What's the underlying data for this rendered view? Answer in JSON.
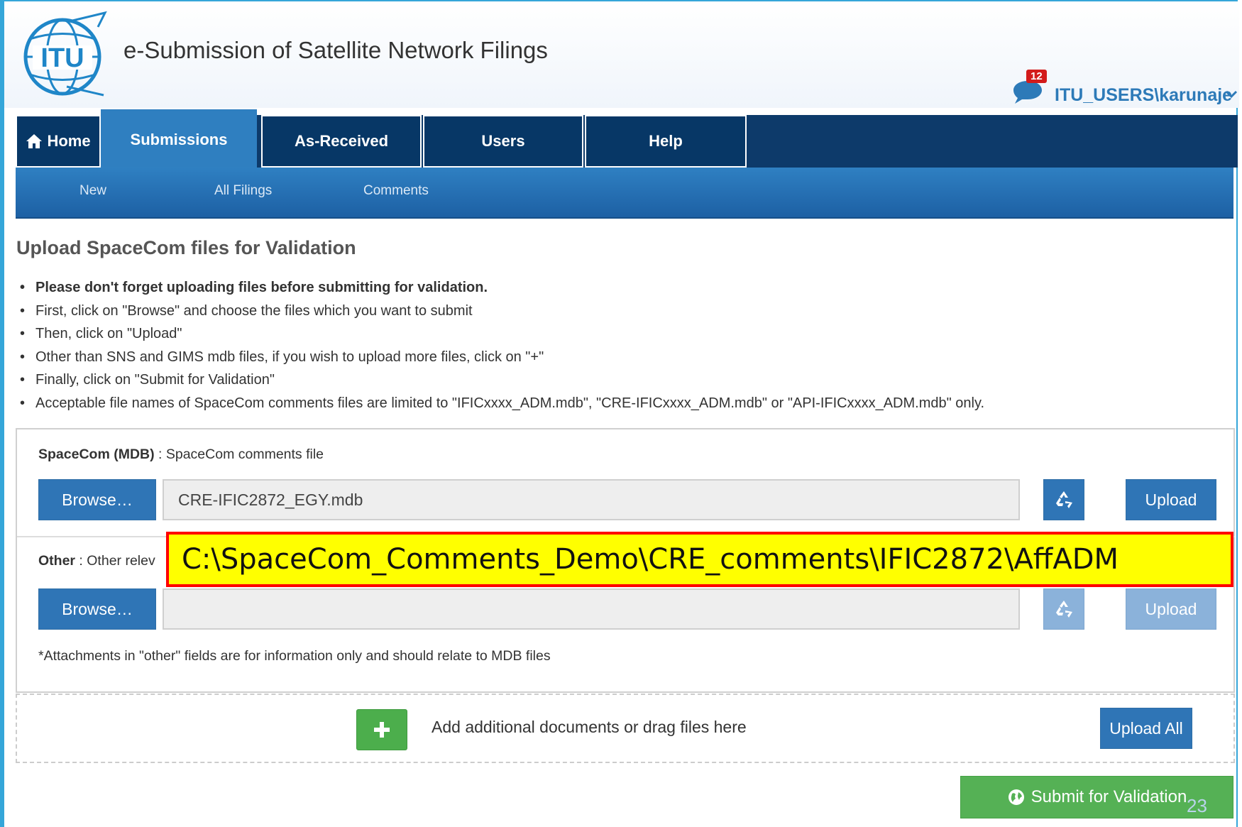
{
  "header": {
    "app_title": "e-Submission of Satellite Network Filings",
    "notification_count": "12",
    "user_name": "ITU_USERS\\karunaje"
  },
  "nav": {
    "items": [
      {
        "label": "Home",
        "icon": "home-icon"
      },
      {
        "label": "Submissions",
        "active": true
      },
      {
        "label": "As-Received"
      },
      {
        "label": "Users"
      },
      {
        "label": "Help"
      }
    ],
    "subitems": [
      "New",
      "All Filings",
      "Comments"
    ]
  },
  "page": {
    "title": "Upload SpaceCom files for Validation",
    "notes": [
      "Please don't forget uploading files before submitting for validation.",
      "First, click on \"Browse\" and choose the files which you want to submit",
      "Then, click on \"Upload\"",
      "Other than SNS and GIMS mdb files, if you wish to upload more files, click on \"+\"",
      "Finally, click on \"Submit for Validation\"",
      "Acceptable file names of SpaceCom comments files are limited to \"IFICxxxx_ADM.mdb\", \"CRE-IFICxxxx_ADM.mdb\" or \"API-IFICxxxx_ADM.mdb\" only."
    ]
  },
  "spacecom": {
    "label_bold": "SpaceCom (MDB)",
    "label_rest": " : SpaceCom comments file",
    "browse_label": "Browse…",
    "file_value": "CRE-IFIC2872_EGY.mdb",
    "upload_label": "Upload"
  },
  "other": {
    "label_bold": "Other",
    "label_rest": " : Other relev",
    "browse_label": "Browse…",
    "file_value": "",
    "upload_label": "Upload"
  },
  "footnote": "*Attachments in \"other\" fields are for information only and should relate to MDB files",
  "dropzone": {
    "text": "Add additional documents or drag files here",
    "upload_all_label": "Upload All"
  },
  "submit_label": "Submit for Validation",
  "page_number": "23",
  "callout_text": "C:\\SpaceCom_Comments_Demo\\CRE_comments\\IFIC2872\\AffADM",
  "colors": {
    "nav_dark": "#0d3a6a",
    "nav_active": "#2f7fc0",
    "button_blue": "#2f75b6",
    "button_green": "#55b155",
    "callout_fill": "#ffff00",
    "callout_border": "#ff0000",
    "badge_red": "#d31b1b"
  }
}
